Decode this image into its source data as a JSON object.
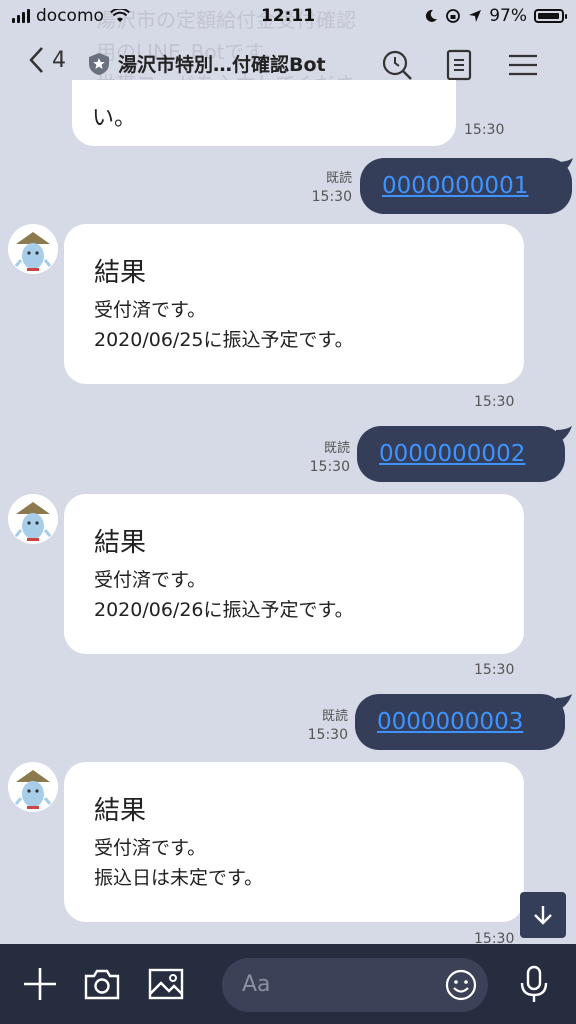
{
  "status": {
    "carrier": "docomo",
    "time": "12:11",
    "battery": "97%"
  },
  "header": {
    "back_count": "4",
    "title": "湯沢市特別…付確認Bot"
  },
  "ghost_text": [
    "湯沢市の定額給付金受付確認",
    "用のLINE_Botです。",
    "世帯コードを入力してくださ"
  ],
  "prev_message": {
    "text": "い。",
    "time": "15:30"
  },
  "conversation": [
    {
      "code": "0000000001",
      "read": "既読",
      "sent_time": "15:30",
      "result_title": "結果",
      "line1": "受付済です。",
      "line2": "2020/06/25に振込予定です。",
      "time": "15:30"
    },
    {
      "code": "0000000002",
      "read": "既読",
      "sent_time": "15:30",
      "result_title": "結果",
      "line1": "受付済です。",
      "line2": "2020/06/26に振込予定です。",
      "time": "15:30"
    },
    {
      "code": "0000000003",
      "read": "既読",
      "sent_time": "15:30",
      "result_title": "結果",
      "line1": "受付済です。",
      "line2": "振込日は未定です。",
      "time": "15:30"
    }
  ],
  "input": {
    "placeholder": "Aa"
  },
  "colors": {
    "background": "#d6dae6",
    "outgoing_bubble": "#343e59",
    "link": "#3f93ff",
    "bottom_bar": "#262d3f"
  },
  "icons": [
    "back-chevron-icon",
    "shield-star-icon",
    "search-icon",
    "notes-icon",
    "menu-icon",
    "plus-icon",
    "camera-icon",
    "image-icon",
    "emoji-icon",
    "mic-icon",
    "arrow-down-icon"
  ]
}
